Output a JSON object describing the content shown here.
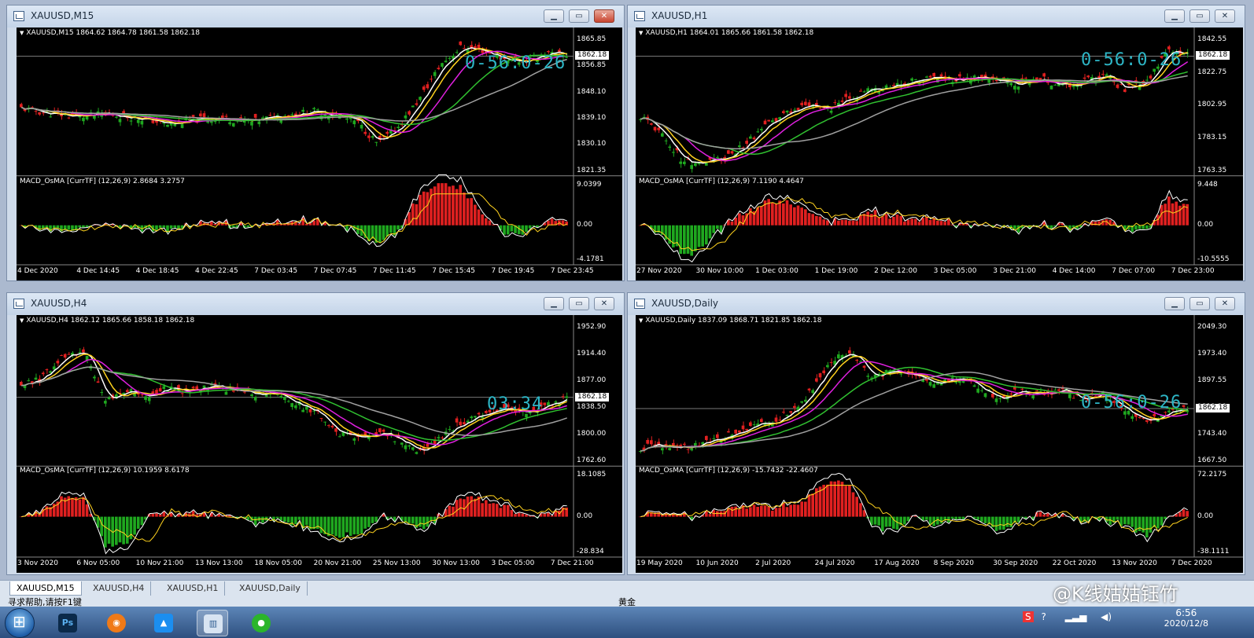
{
  "windows": {
    "m15": {
      "title": "XAUUSD,M15",
      "header": "XAUUSD,M15  1864.62 1864.78 1861.58 1862.18",
      "price_axis": [
        "1865.85",
        "1856.85",
        "1848.10",
        "1839.10",
        "1830.10",
        "1821.35"
      ],
      "current_price": "1862.18",
      "timer": "0-56:0-26",
      "macd_label": "MACD_OsMA [CurrTF] (12,26,9) 2.8684 3.2757",
      "macd_axis": [
        "9.0399",
        "0.00",
        "-4.1781"
      ],
      "x_labels": [
        "4 Dec 2020",
        "4 Dec 14:45",
        "4 Dec 18:45",
        "4 Dec 22:45",
        "7 Dec 03:45",
        "7 Dec 07:45",
        "7 Dec 11:45",
        "7 Dec 15:45",
        "7 Dec 19:45",
        "7 Dec 23:45"
      ]
    },
    "h1": {
      "title": "XAUUSD,H1",
      "header": "XAUUSD,H1  1864.01 1865.66 1861.58 1862.18",
      "price_axis": [
        "1842.55",
        "1822.75",
        "1802.95",
        "1783.15",
        "1763.35"
      ],
      "current_price": "1862.18",
      "timer": "0-56:0-26",
      "macd_label": "MACD_OsMA [CurrTF] (12,26,9) 7.1190 4.4647",
      "macd_axis": [
        "9.448",
        "0.00",
        "-10.5555"
      ],
      "x_labels": [
        "27 Nov 2020",
        "30 Nov 10:00",
        "1 Dec 03:00",
        "1 Dec 19:00",
        "2 Dec 12:00",
        "3 Dec 05:00",
        "3 Dec 21:00",
        "4 Dec 14:00",
        "7 Dec 07:00",
        "7 Dec 23:00"
      ]
    },
    "h4": {
      "title": "XAUUSD,H4",
      "header": "XAUUSD,H4  1862.12 1865.66 1858.18 1862.18",
      "price_axis": [
        "1952.90",
        "1914.40",
        "1877.00",
        "1838.50",
        "1800.00",
        "1762.60"
      ],
      "current_price": "1862.18",
      "timer": "03:34",
      "macd_label": "MACD_OsMA [CurrTF] (12,26,9) 10.1959 8.6178",
      "macd_axis": [
        "18.1085",
        "0.00",
        "-28.834"
      ],
      "x_labels": [
        "3 Nov 2020",
        "6 Nov 05:00",
        "10 Nov 21:00",
        "13 Nov 13:00",
        "18 Nov 05:00",
        "20 Nov 21:00",
        "25 Nov 13:00",
        "30 Nov 13:00",
        "3 Dec 05:00",
        "7 Dec 21:00"
      ]
    },
    "daily": {
      "title": "XAUUSD,Daily",
      "header": "XAUUSD,Daily  1837.09 1868.71 1821.85 1862.18",
      "price_axis": [
        "2049.30",
        "1973.40",
        "1897.55",
        "1819.30",
        "1743.40",
        "1667.50"
      ],
      "current_price": "1862.18",
      "timer": "0-56:0-26",
      "macd_label": "MACD_OsMA [CurrTF] (12,26,9) -15.7432 -22.4607",
      "macd_axis": [
        "72.2175",
        "0.00",
        "-38.1111"
      ],
      "x_labels": [
        "19 May 2020",
        "10 Jun 2020",
        "2 Jul 2020",
        "24 Jul 2020",
        "17 Aug 2020",
        "8 Sep 2020",
        "30 Sep 2020",
        "22 Oct 2020",
        "13 Nov 2020",
        "7 Dec 2020"
      ]
    }
  },
  "window_buttons": {
    "minimize": "▁",
    "restore": "▭",
    "close": "✕"
  },
  "tabs": [
    "XAUUSD,M15",
    "XAUUSD,H4",
    "XAUUSD,H1",
    "XAUUSD,Daily"
  ],
  "status": {
    "left": "寻求帮助,请按F1键",
    "mid": "黄金"
  },
  "clock": {
    "time": "6:56",
    "date": "2020/12/8"
  },
  "watermark": "@K线姑姑钰竹",
  "taskbar_apps": [
    "windows-start",
    "photoshop",
    "app-orange",
    "app-blue",
    "metatrader",
    "wechat"
  ],
  "colors": {
    "bull": "#1fa81f",
    "bear": "#e02020",
    "ma_white": "#ffffff",
    "ma_yellow": "#ffd21e",
    "ma_magenta": "#e020e0",
    "ma_green": "#30c030",
    "ma_gray": "#a0a0a0",
    "timer": "#2db5c5"
  }
}
